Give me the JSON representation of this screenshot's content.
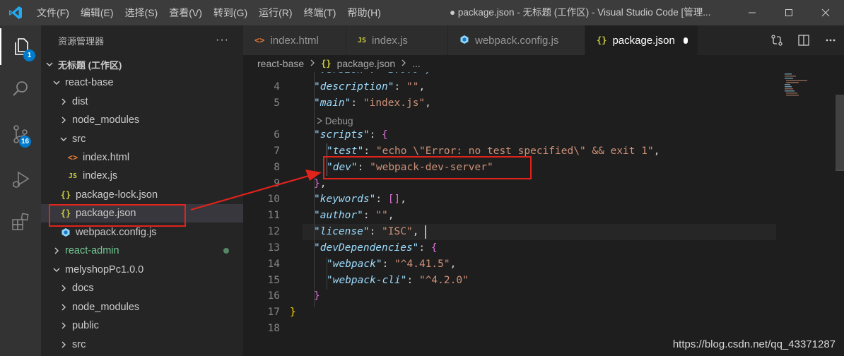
{
  "titlebar": {
    "menu": [
      "文件(F)",
      "编辑(E)",
      "选择(S)",
      "查看(V)",
      "转到(G)",
      "运行(R)",
      "终端(T)",
      "帮助(H)"
    ],
    "window_title": "● package.json - 无标题 (工作区) - Visual Studio Code [管理..."
  },
  "activity": {
    "explorer_badge": "1",
    "scm_badge": "16"
  },
  "sidebar": {
    "title": "资源管理器",
    "more": "···",
    "tree": [
      {
        "label": "无标题 (工作区)",
        "kind": "workspace",
        "expanded": true
      },
      {
        "label": "react-base",
        "kind": "folder",
        "expanded": true
      },
      {
        "label": "dist",
        "kind": "folder",
        "expanded": false
      },
      {
        "label": "node_modules",
        "kind": "folder",
        "expanded": false
      },
      {
        "label": "src",
        "kind": "folder",
        "expanded": true
      },
      {
        "label": "index.html",
        "kind": "html"
      },
      {
        "label": "index.js",
        "kind": "js"
      },
      {
        "label": "package-lock.json",
        "kind": "json"
      },
      {
        "label": "package.json",
        "kind": "json",
        "selected": true
      },
      {
        "label": "webpack.config.js",
        "kind": "webpack"
      },
      {
        "label": "react-admin",
        "kind": "folder",
        "expanded": false,
        "modified": true
      },
      {
        "label": "melyshopPc1.0.0",
        "kind": "folder",
        "expanded": true
      },
      {
        "label": "docs",
        "kind": "folder",
        "expanded": false
      },
      {
        "label": "node_modules",
        "kind": "folder",
        "expanded": false
      },
      {
        "label": "public",
        "kind": "folder",
        "expanded": false
      },
      {
        "label": "src",
        "kind": "folder",
        "expanded": false
      }
    ]
  },
  "tabs": [
    {
      "label": "index.html",
      "icon": "<>",
      "active": false
    },
    {
      "label": "index.js",
      "icon": "JS",
      "active": false
    },
    {
      "label": "webpack.config.js",
      "icon": "webpack-cube",
      "active": false
    },
    {
      "label": "package.json",
      "icon": "{}",
      "active": true,
      "dirty": true
    }
  ],
  "breadcrumbs": {
    "folder": "react-base",
    "file": "package.json",
    "more": "..."
  },
  "editor": {
    "codelens": "Debug",
    "lines": [
      {
        "n": "4",
        "text": "\"description\": \"\","
      },
      {
        "n": "5",
        "text": "\"main\": \"index.js\","
      },
      {
        "n": "6",
        "text": "\"scripts\": {"
      },
      {
        "n": "7",
        "text": "\"test\": \"echo \\\"Error: no test specified\\\" && exit 1\","
      },
      {
        "n": "8",
        "text": "\"dev\": \"webpack-dev-server\""
      },
      {
        "n": "9",
        "text": "},"
      },
      {
        "n": "10",
        "text": "\"keywords\": [],"
      },
      {
        "n": "11",
        "text": "\"author\": \"\","
      },
      {
        "n": "12",
        "text": "\"license\": \"ISC\","
      },
      {
        "n": "13",
        "text": "\"devDependencies\": {"
      },
      {
        "n": "14",
        "text": "\"webpack\": \"^4.41.5\","
      },
      {
        "n": "15",
        "text": "\"webpack-cli\": \"^4.2.0\""
      },
      {
        "n": "16",
        "text": "}"
      },
      {
        "n": "17",
        "text": "}"
      },
      {
        "n": "18",
        "text": ""
      }
    ]
  },
  "watermark": "https://blog.csdn.net/qq_43371287",
  "colors": {
    "annotation": "#e0231b",
    "accent": "#007acc"
  }
}
